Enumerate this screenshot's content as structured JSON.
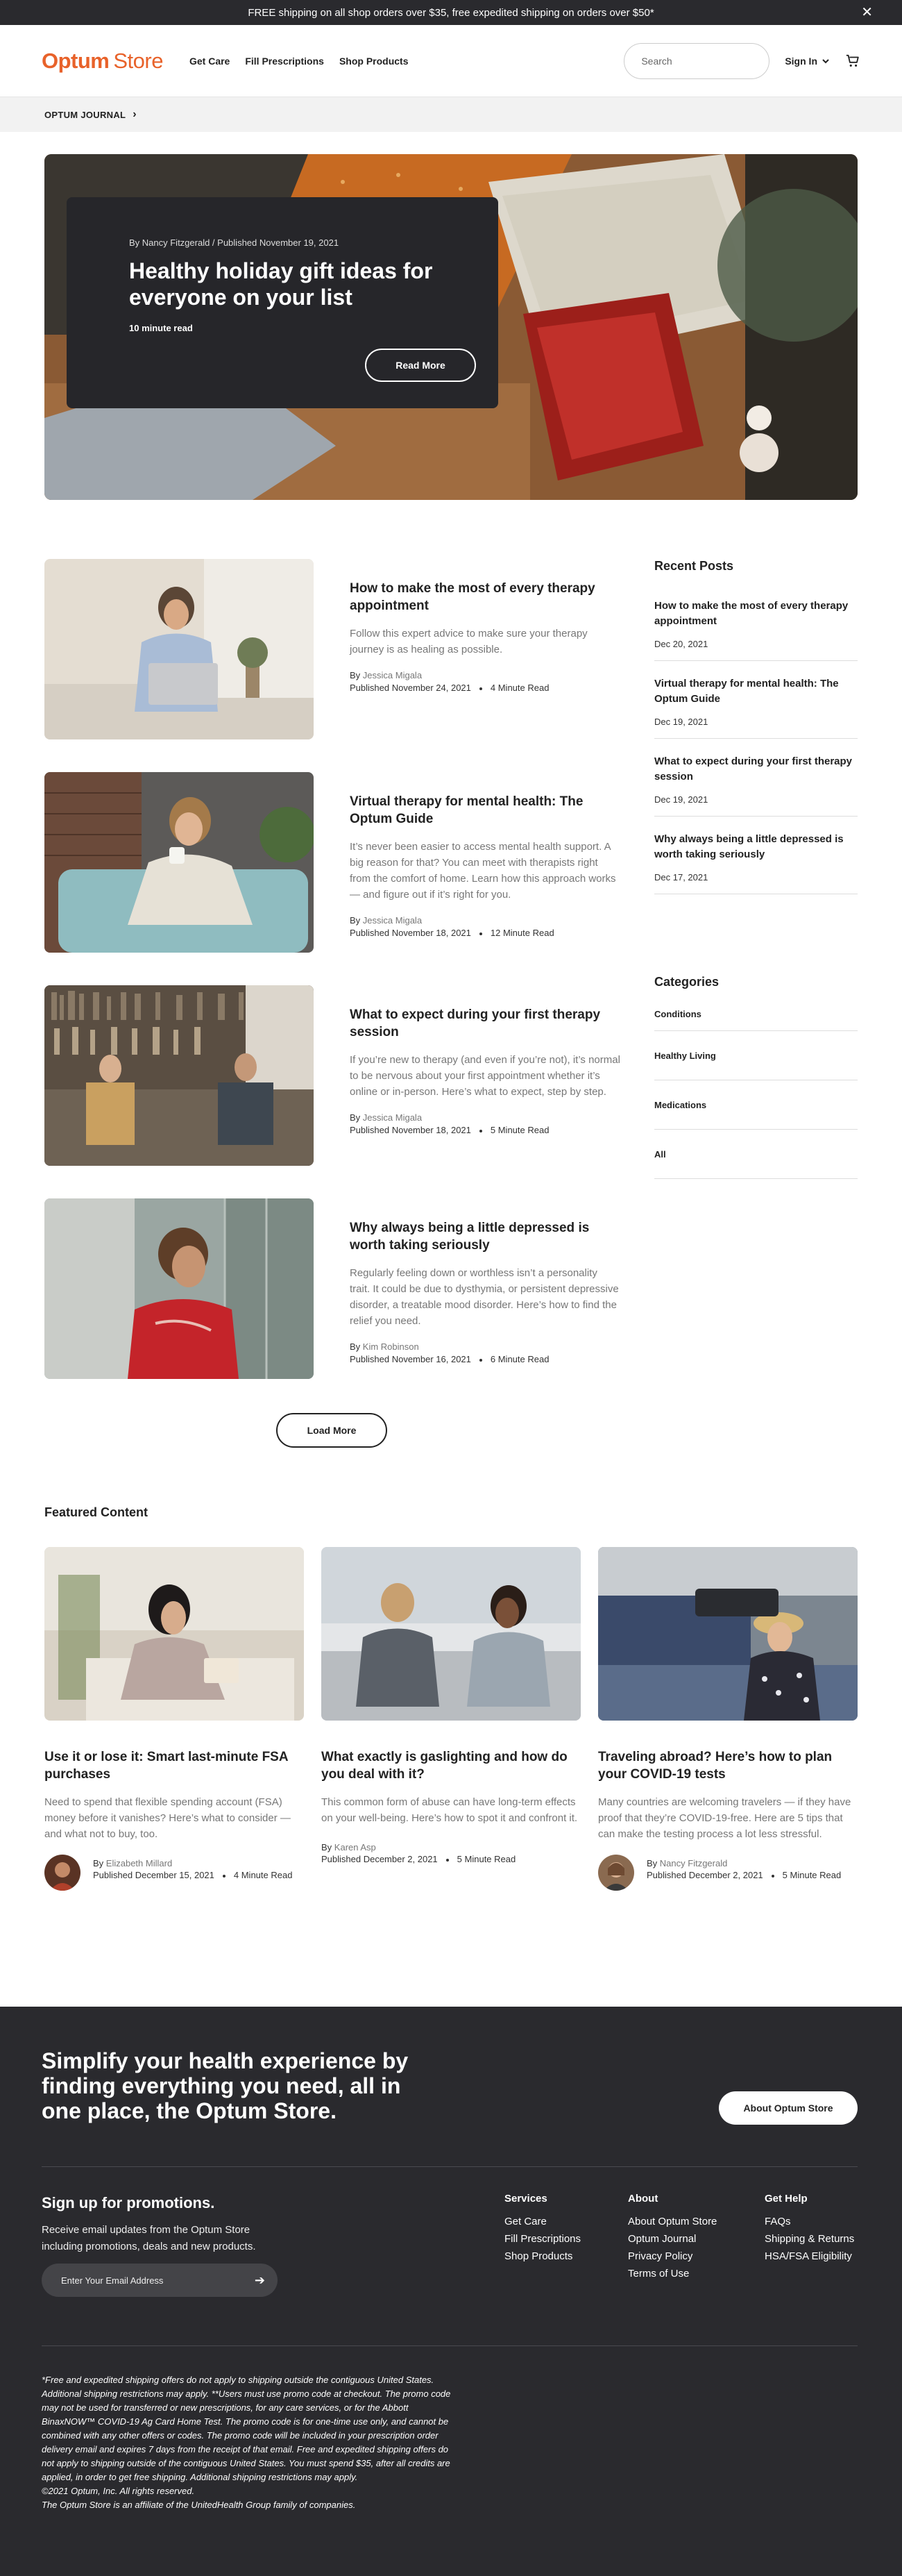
{
  "banner": {
    "text": "FREE shipping on all shop orders over $35, free expedited shipping on orders over $50*"
  },
  "header": {
    "logo_brand": "Optum",
    "logo_store": "Store",
    "nav": [
      "Get Care",
      "Fill Prescriptions",
      "Shop Products"
    ],
    "search_placeholder": "Search",
    "sign_in": "Sign In"
  },
  "breadcrumb": {
    "label": "OPTUM JOURNAL"
  },
  "hero": {
    "meta": "By Nancy Fitzgerald / Published November 19, 2021",
    "title": "Healthy holiday gift ideas for everyone on your list",
    "read_time": "10 minute read",
    "button": "Read More"
  },
  "articles": [
    {
      "title": "How to make the most of every therapy appointment",
      "desc": "Follow this expert advice to make sure your therapy journey is as healing as possible.",
      "by": "By ",
      "author": "Jessica Migala",
      "published": "Published November 24, 2021",
      "read": "4 Minute Read"
    },
    {
      "title": "Virtual therapy for mental health: The Optum Guide",
      "desc": "It’s never been easier to access mental health support. A big reason for that? You can meet with therapists right from the comfort of home. Learn how this approach works — and figure out if it’s right for you.",
      "by": "By ",
      "author": "Jessica Migala",
      "published": "Published November 18, 2021",
      "read": "12 Minute Read"
    },
    {
      "title": "What to expect during your first therapy session",
      "desc": "If you’re new to therapy (and even if you’re not), it’s normal to be nervous about your first appointment whether it’s online or in-person. Here’s what to expect, step by step.",
      "by": "By ",
      "author": "Jessica Migala",
      "published": "Published November 18, 2021",
      "read": "5 Minute Read"
    },
    {
      "title": "Why always being a little depressed is worth taking seriously",
      "desc": "Regularly feeling down or worthless isn’t a personality trait. It could be due to dysthymia, or persistent depressive disorder, a treatable mood disorder. Here’s how to find the relief you need.",
      "by": "By ",
      "author": "Kim Robinson",
      "published": "Published November 16, 2021",
      "read": "6 Minute Read"
    }
  ],
  "load_more": "Load More",
  "recent": {
    "heading": "Recent Posts",
    "items": [
      {
        "title": "How to make the most of every therapy appointment",
        "date": "Dec 20, 2021"
      },
      {
        "title": "Virtual therapy for mental health: The Optum Guide",
        "date": "Dec 19, 2021"
      },
      {
        "title": "What to expect during your first therapy session",
        "date": "Dec 19, 2021"
      },
      {
        "title": "Why always being a little depressed is worth taking seriously",
        "date": "Dec 17, 2021"
      }
    ]
  },
  "categories": {
    "heading": "Categories",
    "items": [
      "Conditions",
      "Healthy Living",
      "Medications",
      "All"
    ]
  },
  "featured": {
    "heading": "Featured Content",
    "items": [
      {
        "title": "Use it or lose it: Smart last-minute FSA purchases",
        "desc": "Need to spend that flexible spending account (FSA) money before it vanishes? Here’s what to consider — and what not to buy, too.",
        "by": "By ",
        "author": "Elizabeth Millard",
        "published": "Published December 15, 2021",
        "read": "4 Minute Read"
      },
      {
        "title": "What exactly is gaslighting and how do you deal with it?",
        "desc": "This common form of abuse can have long-term effects on your well-being. Here’s how to spot it and confront it.",
        "by": "By ",
        "author": "Karen Asp",
        "published": "Published December 2, 2021",
        "read": "5 Minute Read"
      },
      {
        "title": "Traveling abroad? Here’s how to plan your COVID-19 tests",
        "desc": "Many countries are welcoming travelers — if they have proof that they’re COVID-19-free. Here are 5 tips that can make the testing process a lot less stressful.",
        "by": "By ",
        "author": "Nancy Fitzgerald",
        "published": "Published December 2, 2021",
        "read": "5 Minute Read"
      }
    ]
  },
  "footer": {
    "tagline": "Simplify your health experience by finding everything you need, all in one place, the Optum Store.",
    "about_button": "About Optum Store",
    "signup_title": "Sign up for promotions.",
    "signup_desc": "Receive email updates from the Optum Store including promotions, deals and new products.",
    "email_placeholder": "Enter Your Email Address",
    "columns": [
      {
        "heading": "Services",
        "links": [
          "Get Care",
          "Fill Prescriptions",
          "Shop Products"
        ]
      },
      {
        "heading": "About",
        "links": [
          "About Optum Store",
          "Optum Journal",
          "Privacy Policy",
          "Terms of Use"
        ]
      },
      {
        "heading": "Get Help",
        "links": [
          "FAQs",
          "Shipping & Returns",
          "HSA/FSA Eligibility"
        ]
      }
    ],
    "legal": "*Free and expedited shipping offers do not apply to shipping outside the contiguous United States. Additional shipping restrictions may apply. **Users must use promo code at checkout. The promo code may not be used for transferred or new prescriptions, for any care services, or for the Abbott BinaxNOW™ COVID-19 Ag Card Home Test. The promo code is for one-time use only, and cannot be combined with any other offers or codes. The promo code will be included in your prescription order delivery email and expires 7 days from the receipt of that email. Free and expedited shipping offers do not apply to shipping outside of the contiguous United States. You must spend $35, after all credits are applied, in order to get free shipping. Additional shipping restrictions may apply.",
    "copyright": "©2021 Optum, Inc. All rights reserved.",
    "affiliate": "The Optum Store is an affiliate of the UnitedHealth Group family of companies."
  },
  "colors": {
    "brand": "#e8622a",
    "dark": "#2a2a2e",
    "muted_text": "#777777"
  }
}
